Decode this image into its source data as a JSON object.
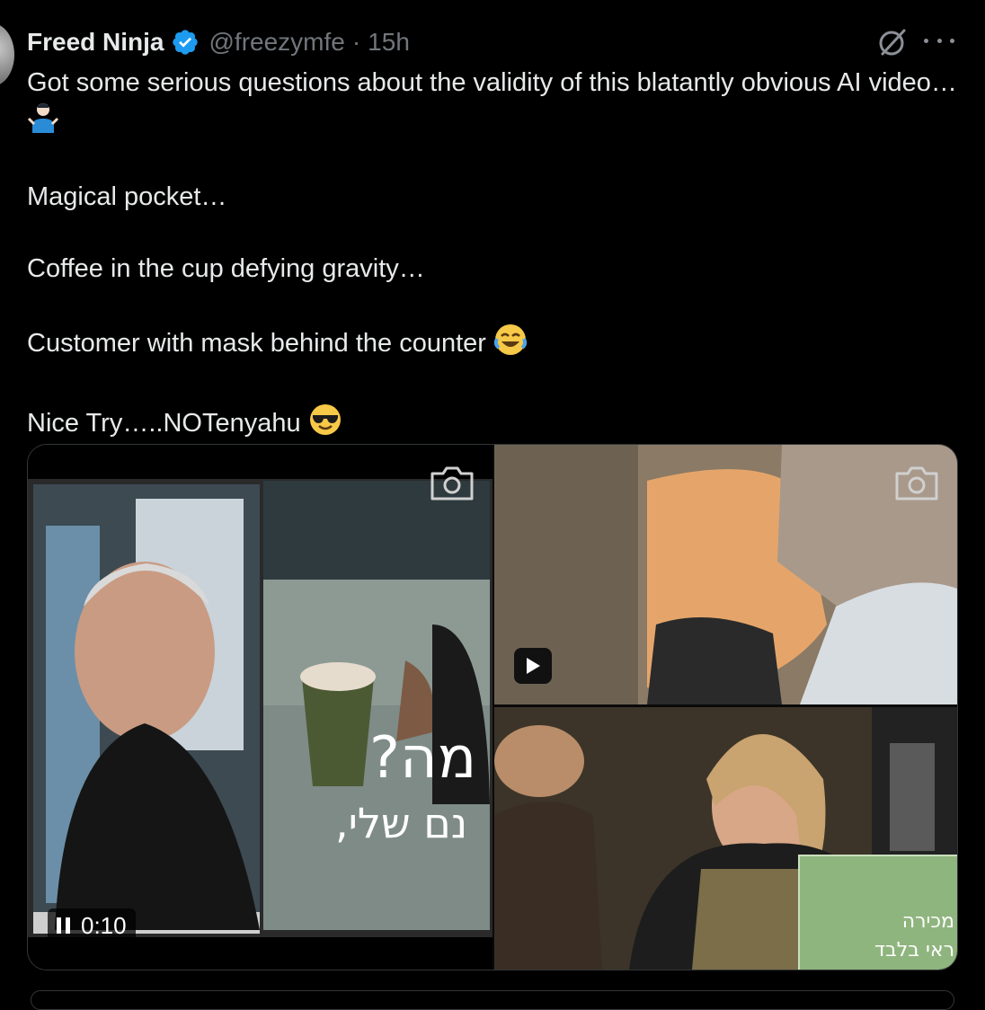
{
  "post": {
    "author_name": "Freed Ninja",
    "handle": "@freezymfe",
    "separator": "·",
    "time": "15h",
    "paragraphs": [
      "Got some serious questions about the validity of this blatantly obvious AI video…",
      "Magical pocket…",
      "Coffee in the cup defying gravity…",
      "Customer with mask behind the counter",
      "Nice Try…..NOTenyahu"
    ],
    "emojis": [
      "person-shrugging",
      "face-with-tears-of-joy",
      "smiling-face-with-sunglasses"
    ]
  },
  "media": {
    "video_time": "0:10",
    "overlay_text_line1": "מה?",
    "overlay_text_line2": "נם שלי,",
    "sign_line1": "מכירה",
    "sign_line2": "ראי בלבד"
  },
  "icons": {
    "verified": "verified-badge-icon",
    "grok": "grok-icon",
    "more": "more-icon",
    "camera": "camera-icon",
    "play": "play-icon",
    "pause": "pause-icon"
  },
  "colors": {
    "background": "#000000",
    "text": "#e7e9ea",
    "secondary_text": "#71767b",
    "verified": "#1d9bf0",
    "border": "#333639"
  }
}
